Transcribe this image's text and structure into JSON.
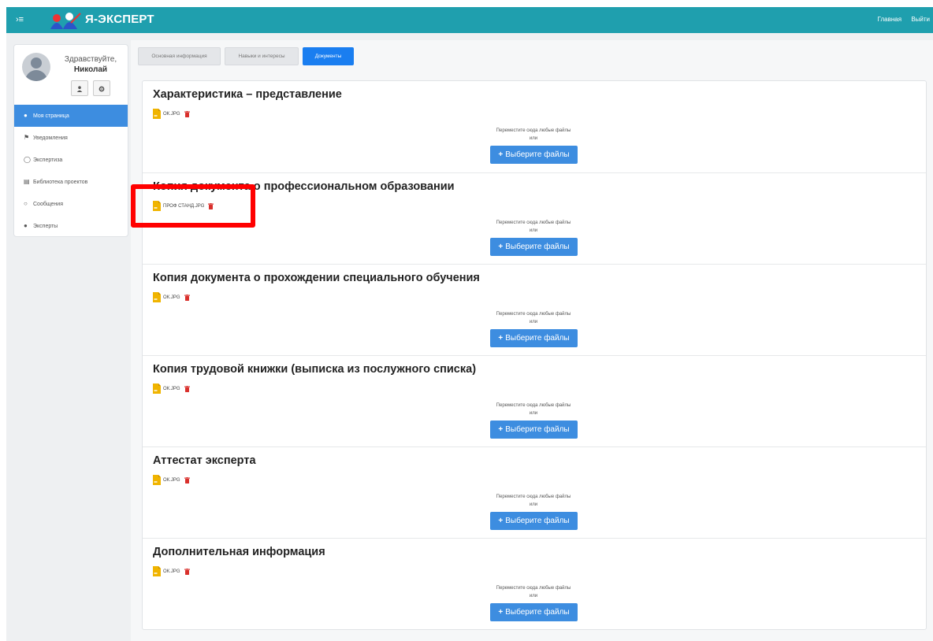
{
  "header": {
    "toggle": "›≡",
    "brand": "Я-ЭКСПЕРТ",
    "links": [
      "Главная",
      "Выйти"
    ]
  },
  "profile": {
    "greeting": "Здравствуйте,",
    "name": "Николай"
  },
  "menu": [
    {
      "label": "Моя страница",
      "icon": "user-icon",
      "active": true
    },
    {
      "label": "Уведомления",
      "icon": "flag-icon",
      "active": false
    },
    {
      "label": "Экспертиза",
      "icon": "circle-check-icon",
      "active": false
    },
    {
      "label": "Библиотека проектов",
      "icon": "keyboard-icon",
      "active": false
    },
    {
      "label": "Сообщения",
      "icon": "chat-icon",
      "active": false
    },
    {
      "label": "Эксперты",
      "icon": "users-icon",
      "active": false
    }
  ],
  "tabs": [
    {
      "label": "Основная информация",
      "active": false
    },
    {
      "label": "Навыки и интересы",
      "active": false
    },
    {
      "label": "Документы",
      "active": true
    }
  ],
  "sections": [
    {
      "title": "Характеристика – представление",
      "file": "ОК.JPG"
    },
    {
      "title": "Копия документа о профессиональном образовании",
      "file": "ПРОФ СТАНД.JPG"
    },
    {
      "title": "Копия документа о прохождении специального обучения",
      "file": "ОК.JPG"
    },
    {
      "title": "Копия трудовой книжки (выписка из послужного списка)",
      "file": "ОК.JPG"
    },
    {
      "title": "Аттестат эксперта",
      "file": "ОК.JPG"
    },
    {
      "title": "Дополнительная информация",
      "file": "ОК.JPG"
    }
  ],
  "upload": {
    "drop_text": "Переместите сюда любые файлы",
    "or_text": "или",
    "button_label": "Выберите файлы"
  },
  "colors": {
    "navbar": "#1f9fae",
    "primary": "#3d8de0",
    "highlight": "#ff0000",
    "file_icon": "#f0b400",
    "trash": "#d9302c"
  }
}
